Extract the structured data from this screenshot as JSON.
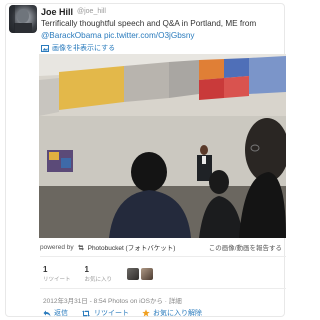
{
  "tweet": {
    "name": "Joe Hill",
    "handle": "@joe_hill",
    "text_main": "Terrifically thoughtful speech and Q&A in Portland, ME from ",
    "mention": "@BarackObama",
    "link": "pic.twitter.com/O3jGbsny",
    "hide_media": "画像を非表示にする"
  },
  "photo_footer": {
    "powered_by": "powered by",
    "provider": "Photobucket (フォトバケット)",
    "report": "この画像/動画を報告する"
  },
  "stats": {
    "retweets_count": "1",
    "retweets_label": "リツイート",
    "favorites_count": "1",
    "favorites_label": "お気に入り"
  },
  "timestamp": "2012年3月31日 - 8:54 Photos on iOSから · 詳細",
  "actions": {
    "reply": "返信",
    "retweet": "リツイート",
    "favorite": "お気に入り解除"
  },
  "colors": {
    "link": "#2a7bbd",
    "favorite_star": "#f0a020"
  }
}
